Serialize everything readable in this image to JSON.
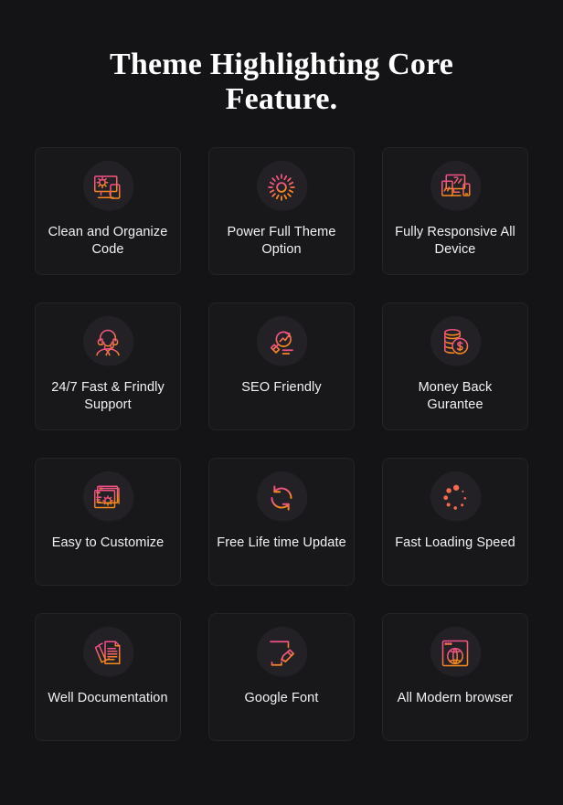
{
  "heading": "Theme Highlighting Core Feature.",
  "colors": {
    "background": "#141417",
    "card_background": "#18181b",
    "card_border": "#242427",
    "icon_blob": "#232126",
    "text": "#f2f2f3",
    "heading_text": "#ffffff",
    "gradient_start": "#ef4c8c",
    "gradient_mid": "#f2636b",
    "gradient_end": "#f78a1e"
  },
  "features": [
    {
      "icon": "monitor-gear-mobile-icon",
      "label": "Clean and Organize Code"
    },
    {
      "icon": "gear-icon",
      "label": "Power Full Theme Option"
    },
    {
      "icon": "responsive-devices-icon",
      "label": "Fully Responsive All Device"
    },
    {
      "icon": "headset-support-agent-icon",
      "label": "24/7 Fast & Frindly Support"
    },
    {
      "icon": "magnifier-growth-arrow-icon",
      "label": "SEO Friendly"
    },
    {
      "icon": "coins-dollar-icon",
      "label": "Money Back Gurantee"
    },
    {
      "icon": "windows-gear-icon",
      "label": "Easy to Customize"
    },
    {
      "icon": "refresh-arrows-icon",
      "label": "Free Life time Update"
    },
    {
      "icon": "loading-spinner-dots-icon",
      "label": "Fast Loading Speed"
    },
    {
      "icon": "documents-stack-icon",
      "label": "Well Documentation"
    },
    {
      "icon": "typography-t-pen-icon",
      "label": "Google Font"
    },
    {
      "icon": "browser-globe-icon",
      "label": "All Modern browser"
    }
  ]
}
